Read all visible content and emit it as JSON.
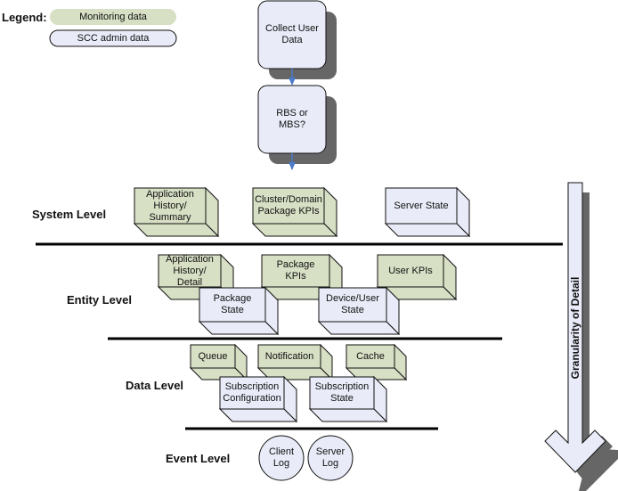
{
  "legend": {
    "title": "Legend:",
    "items": [
      {
        "label": "Monitoring data",
        "color": "#d7dfc4"
      },
      {
        "label": "SCC admin data",
        "color": "#e9ecf8"
      }
    ]
  },
  "flow": [
    {
      "label": "Collect User\nData"
    },
    {
      "label": "RBS or\nMBS?"
    }
  ],
  "levels": [
    {
      "label": "System Level"
    },
    {
      "label": "Entity Level"
    },
    {
      "label": "Data Level"
    },
    {
      "label": "Event Level"
    }
  ],
  "boxes": {
    "system": [
      {
        "label": "Application\nHistory/\nSummary",
        "type": "monitoring"
      },
      {
        "label": "Cluster/Domain\nPackage KPIs",
        "type": "monitoring"
      },
      {
        "label": "Server State",
        "type": "admin"
      }
    ],
    "entity": [
      {
        "label": "Application\nHistory/\nDetail",
        "type": "monitoring"
      },
      {
        "label": "Package\nKPIs",
        "type": "monitoring"
      },
      {
        "label": "User KPIs",
        "type": "monitoring"
      },
      {
        "label": "Package\nState",
        "type": "admin"
      },
      {
        "label": "Device/User\nState",
        "type": "admin"
      }
    ],
    "data": [
      {
        "label": "Queue",
        "type": "monitoring"
      },
      {
        "label": "Notification",
        "type": "monitoring"
      },
      {
        "label": "Cache",
        "type": "monitoring"
      },
      {
        "label": "Subscription\nConfiguration",
        "type": "admin"
      },
      {
        "label": "Subscription\nState",
        "type": "admin"
      }
    ],
    "event": [
      {
        "label": "Client\nLog",
        "type": "admin"
      },
      {
        "label": "Server\nLog",
        "type": "admin"
      }
    ]
  },
  "arrow": {
    "label": "Granularity of Detail"
  },
  "colors": {
    "monitoring": "#d7dfc4",
    "admin": "#e9ecf8",
    "shadow": "#666666",
    "flow_arrow": "#4a7ac8"
  }
}
